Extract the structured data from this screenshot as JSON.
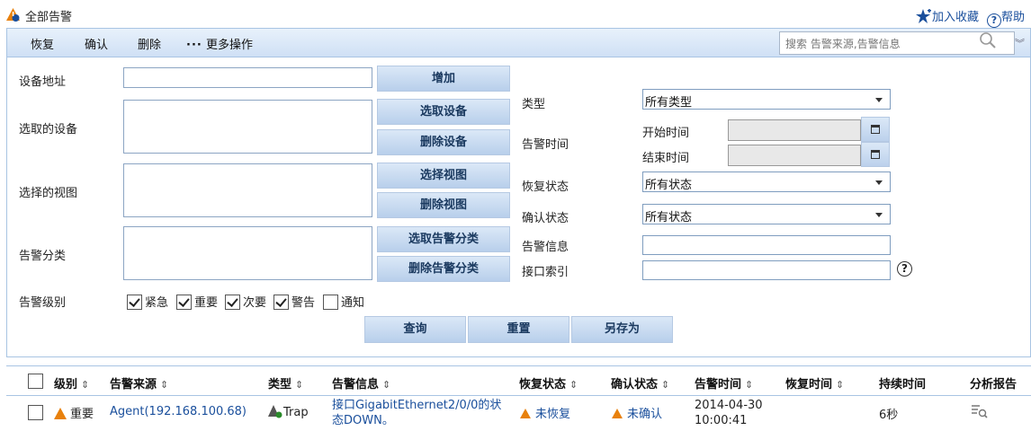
{
  "title": "全部告警",
  "header_links": {
    "favorite": "加入收藏",
    "help": "帮助"
  },
  "toolbar": {
    "restore": "恢复",
    "confirm": "确认",
    "delete": "删除",
    "more": "更多操作",
    "search_placeholder": "搜索 告警来源,告警信息"
  },
  "form": {
    "device_address": "设备地址",
    "selected_devices": "选取的设备",
    "selected_views": "选择的视图",
    "alarm_category": "告警分类",
    "alarm_level": "告警级别",
    "btn_add": "增加",
    "btn_select_device": "选取设备",
    "btn_delete_device": "删除设备",
    "btn_select_view": "选择视图",
    "btn_delete_view": "删除视图",
    "btn_select_category": "选取告警分类",
    "btn_delete_category": "删除告警分类",
    "type": "类型",
    "type_value": "所有类型",
    "alarm_time": "告警时间",
    "start_time": "开始时间",
    "end_time": "结束时间",
    "restore_status": "恢复状态",
    "restore_status_value": "所有状态",
    "confirm_status": "确认状态",
    "confirm_status_value": "所有状态",
    "alarm_info": "告警信息",
    "interface_index": "接口索引",
    "levels": [
      {
        "label": "紧急",
        "checked": true
      },
      {
        "label": "重要",
        "checked": true
      },
      {
        "label": "次要",
        "checked": true
      },
      {
        "label": "警告",
        "checked": true
      },
      {
        "label": "通知",
        "checked": false
      }
    ],
    "btn_query": "查询",
    "btn_reset": "重置",
    "btn_save_as": "另存为"
  },
  "table": {
    "headers": {
      "level": "级别",
      "source": "告警来源",
      "type": "类型",
      "info": "告警信息",
      "restore": "恢复状态",
      "confirm": "确认状态",
      "time": "告警时间",
      "restore_time": "恢复时间",
      "duration": "持续时间",
      "report": "分析报告"
    },
    "rows": [
      {
        "level": "重要",
        "source": "Agent(192.168.100.68)",
        "type": "Trap",
        "info1": "接口GigabitEthernet2/0/0的状",
        "info2": "态DOWN。",
        "restore": "未恢复",
        "confirm": "未确认",
        "date": "2014-04-30",
        "time": "10:00:41",
        "duration": "6秒"
      }
    ]
  },
  "colors": {
    "accent": "#1a4f9c",
    "toolbar_bg": "#cfe0f5",
    "warning": "#e8810c"
  }
}
